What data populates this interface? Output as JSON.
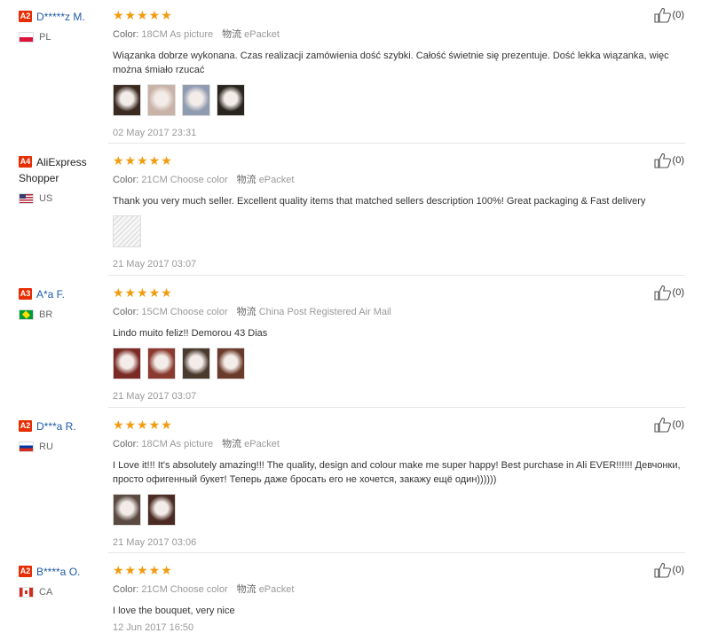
{
  "reviews": [
    {
      "badge": "A2",
      "name": "D*****z M.",
      "country": "PL",
      "flag": "pl",
      "color_label": "Color:",
      "color_value": "18CM As picture",
      "ship_label": "物流",
      "ship_value": "ePacket",
      "text": "Wiązanka dobrze wykonana. Czas realizacji zamówienia dość szybki. Całość świetnie się prezentuje. Dość lekka wiązanka, więc można śmiało rzucać",
      "photos": [
        "#3b2a22",
        "#c9b2a6",
        "#8f9bb0",
        "#2a241f"
      ],
      "date": "02 May 2017 23:31",
      "helpful": "(0)"
    },
    {
      "badge": "A4",
      "name": "AliExpress Shopper",
      "country": "US",
      "flag": "us",
      "color_label": "Color:",
      "color_value": "21CM Choose color",
      "ship_label": "物流",
      "ship_value": "ePacket",
      "text": "Thank you very much seller. Excellent quality items that matched sellers description 100%! Great packaging & Fast delivery",
      "photos": [
        "#efefef"
      ],
      "date": "21 May 2017 03:07",
      "helpful": "(0)"
    },
    {
      "badge": "A3",
      "name": "A*a F.",
      "country": "BR",
      "flag": "br",
      "color_label": "Color:",
      "color_value": "15CM Choose color",
      "ship_label": "物流",
      "ship_value": "China Post Registered Air Mail",
      "text": "Lindo muito feliz!! Demorou 43 Dias",
      "photos": [
        "#7a2a24",
        "#8a3a2e",
        "#4a3a2e",
        "#6a3a2a"
      ],
      "date": "21 May 2017 03:07",
      "helpful": "(0)"
    },
    {
      "badge": "A2",
      "name": "D***a R.",
      "country": "RU",
      "flag": "ru",
      "color_label": "Color:",
      "color_value": "18CM As picture",
      "ship_label": "物流",
      "ship_value": "ePacket",
      "text": "I Love it!!! It's absolutely amazing!!! The quality, design and colour make me super happy! Best purchase in Ali EVER!!!!!! Девчонки, просто офигенный букет! Теперь даже бросать его не хочется, закажу ещё один))))))",
      "photos": [
        "#5a4a42",
        "#4a2a22"
      ],
      "date": "21 May 2017 03:06",
      "helpful": "(0)"
    },
    {
      "badge": "A2",
      "name": "B****a O.",
      "country": "CA",
      "flag": "ca",
      "color_label": "Color:",
      "color_value": "21CM Choose color",
      "ship_label": "物流",
      "ship_value": "ePacket",
      "text": "I love the bouquet, very nice",
      "photos": [],
      "date": "12 Jun 2017 16:50",
      "helpful": "(0)"
    }
  ],
  "stars": "★★★★★",
  "icons": {
    "thumb": "thumbs-up-icon"
  }
}
